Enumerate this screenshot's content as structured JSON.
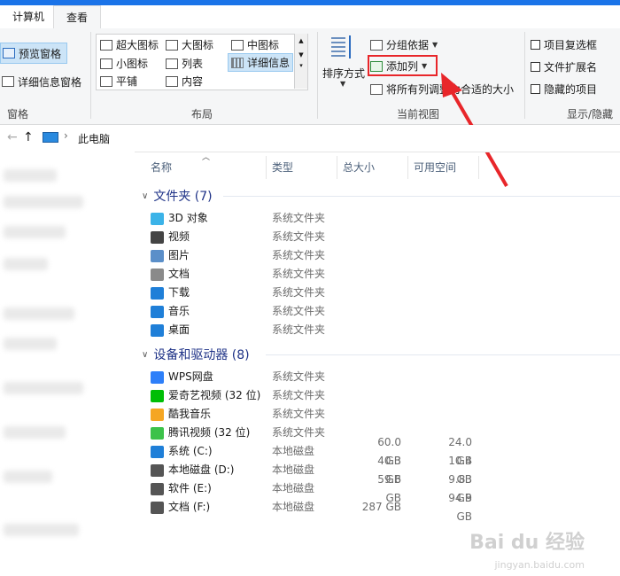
{
  "tabs": {
    "computer": "计算机",
    "view": "查看"
  },
  "ribbon": {
    "pane": {
      "preview": "预览窗格",
      "details": "详细信息窗格",
      "label": "窗格"
    },
    "layout": {
      "items": [
        "超大图标",
        "大图标",
        "中图标",
        "小图标",
        "列表",
        "详细信息",
        "平铺",
        "内容"
      ],
      "label": "布局"
    },
    "current_view": {
      "sort": "排序方式",
      "group": "分组依据",
      "add_column": "添加列",
      "fit_columns": "将所有列调整为合适的大小",
      "label": "当前视图"
    },
    "show_hide": {
      "item_checkbox": "项目复选框",
      "file_ext": "文件扩展名",
      "hidden_items": "隐藏的项目",
      "label": "显示/隐藏"
    }
  },
  "address": {
    "location": "此电脑"
  },
  "columns": {
    "name": "名称",
    "type": "类型",
    "total": "总大小",
    "free": "可用空间"
  },
  "folders": {
    "title": "文件夹 (7)",
    "items": [
      {
        "name": "3D 对象",
        "type": "系统文件夹",
        "icon": "cube-icon",
        "color": "#3bb3e8"
      },
      {
        "name": "视频",
        "type": "系统文件夹",
        "icon": "film-icon",
        "color": "#444444"
      },
      {
        "name": "图片",
        "type": "系统文件夹",
        "icon": "picture-icon",
        "color": "#5b8fc9"
      },
      {
        "name": "文档",
        "type": "系统文件夹",
        "icon": "document-icon",
        "color": "#8a8a8a"
      },
      {
        "name": "下载",
        "type": "系统文件夹",
        "icon": "download-arrow-icon",
        "color": "#1f7fd8"
      },
      {
        "name": "音乐",
        "type": "系统文件夹",
        "icon": "music-note-icon",
        "color": "#1f7fd8"
      },
      {
        "name": "桌面",
        "type": "系统文件夹",
        "icon": "desktop-icon",
        "color": "#1f7fd8"
      }
    ]
  },
  "devices": {
    "title": "设备和驱动器 (8)",
    "items": [
      {
        "name": "WPS网盘",
        "type": "系统文件夹",
        "total": "",
        "free": "",
        "icon": "cloud-icon",
        "color": "#2d7ff9"
      },
      {
        "name": "爱奇艺视频 (32 位)",
        "type": "系统文件夹",
        "total": "",
        "free": "",
        "icon": "iqiyi-icon",
        "color": "#00be06"
      },
      {
        "name": "酷我音乐",
        "type": "系统文件夹",
        "total": "",
        "free": "",
        "icon": "kuwo-icon",
        "color": "#f5a623"
      },
      {
        "name": "腾讯视频 (32 位)",
        "type": "系统文件夹",
        "total": "",
        "free": "",
        "icon": "tencent-video-icon",
        "color": "#3cc24a"
      },
      {
        "name": "系统 (C:)",
        "type": "本地磁盘",
        "total": "60.0 GB",
        "free": "24.0 GB",
        "icon": "windows-drive-icon",
        "color": "#1f7fd8"
      },
      {
        "name": "本地磁盘 (D:)",
        "type": "本地磁盘",
        "total": "40.3 GB",
        "free": "10.4 GB",
        "icon": "drive-icon",
        "color": "#555555"
      },
      {
        "name": "软件 (E:)",
        "type": "本地磁盘",
        "total": "59.6 GB",
        "free": "9.83 GB",
        "icon": "drive-icon",
        "color": "#555555"
      },
      {
        "name": "文档 (F:)",
        "type": "本地磁盘",
        "total": "287 GB",
        "free": "94.9 GB",
        "icon": "drive-icon",
        "color": "#555555"
      }
    ]
  },
  "annotation_color": "#e8262a",
  "watermark": {
    "main": "Bai du 经验",
    "sub": "jingyan.baidu.com"
  }
}
